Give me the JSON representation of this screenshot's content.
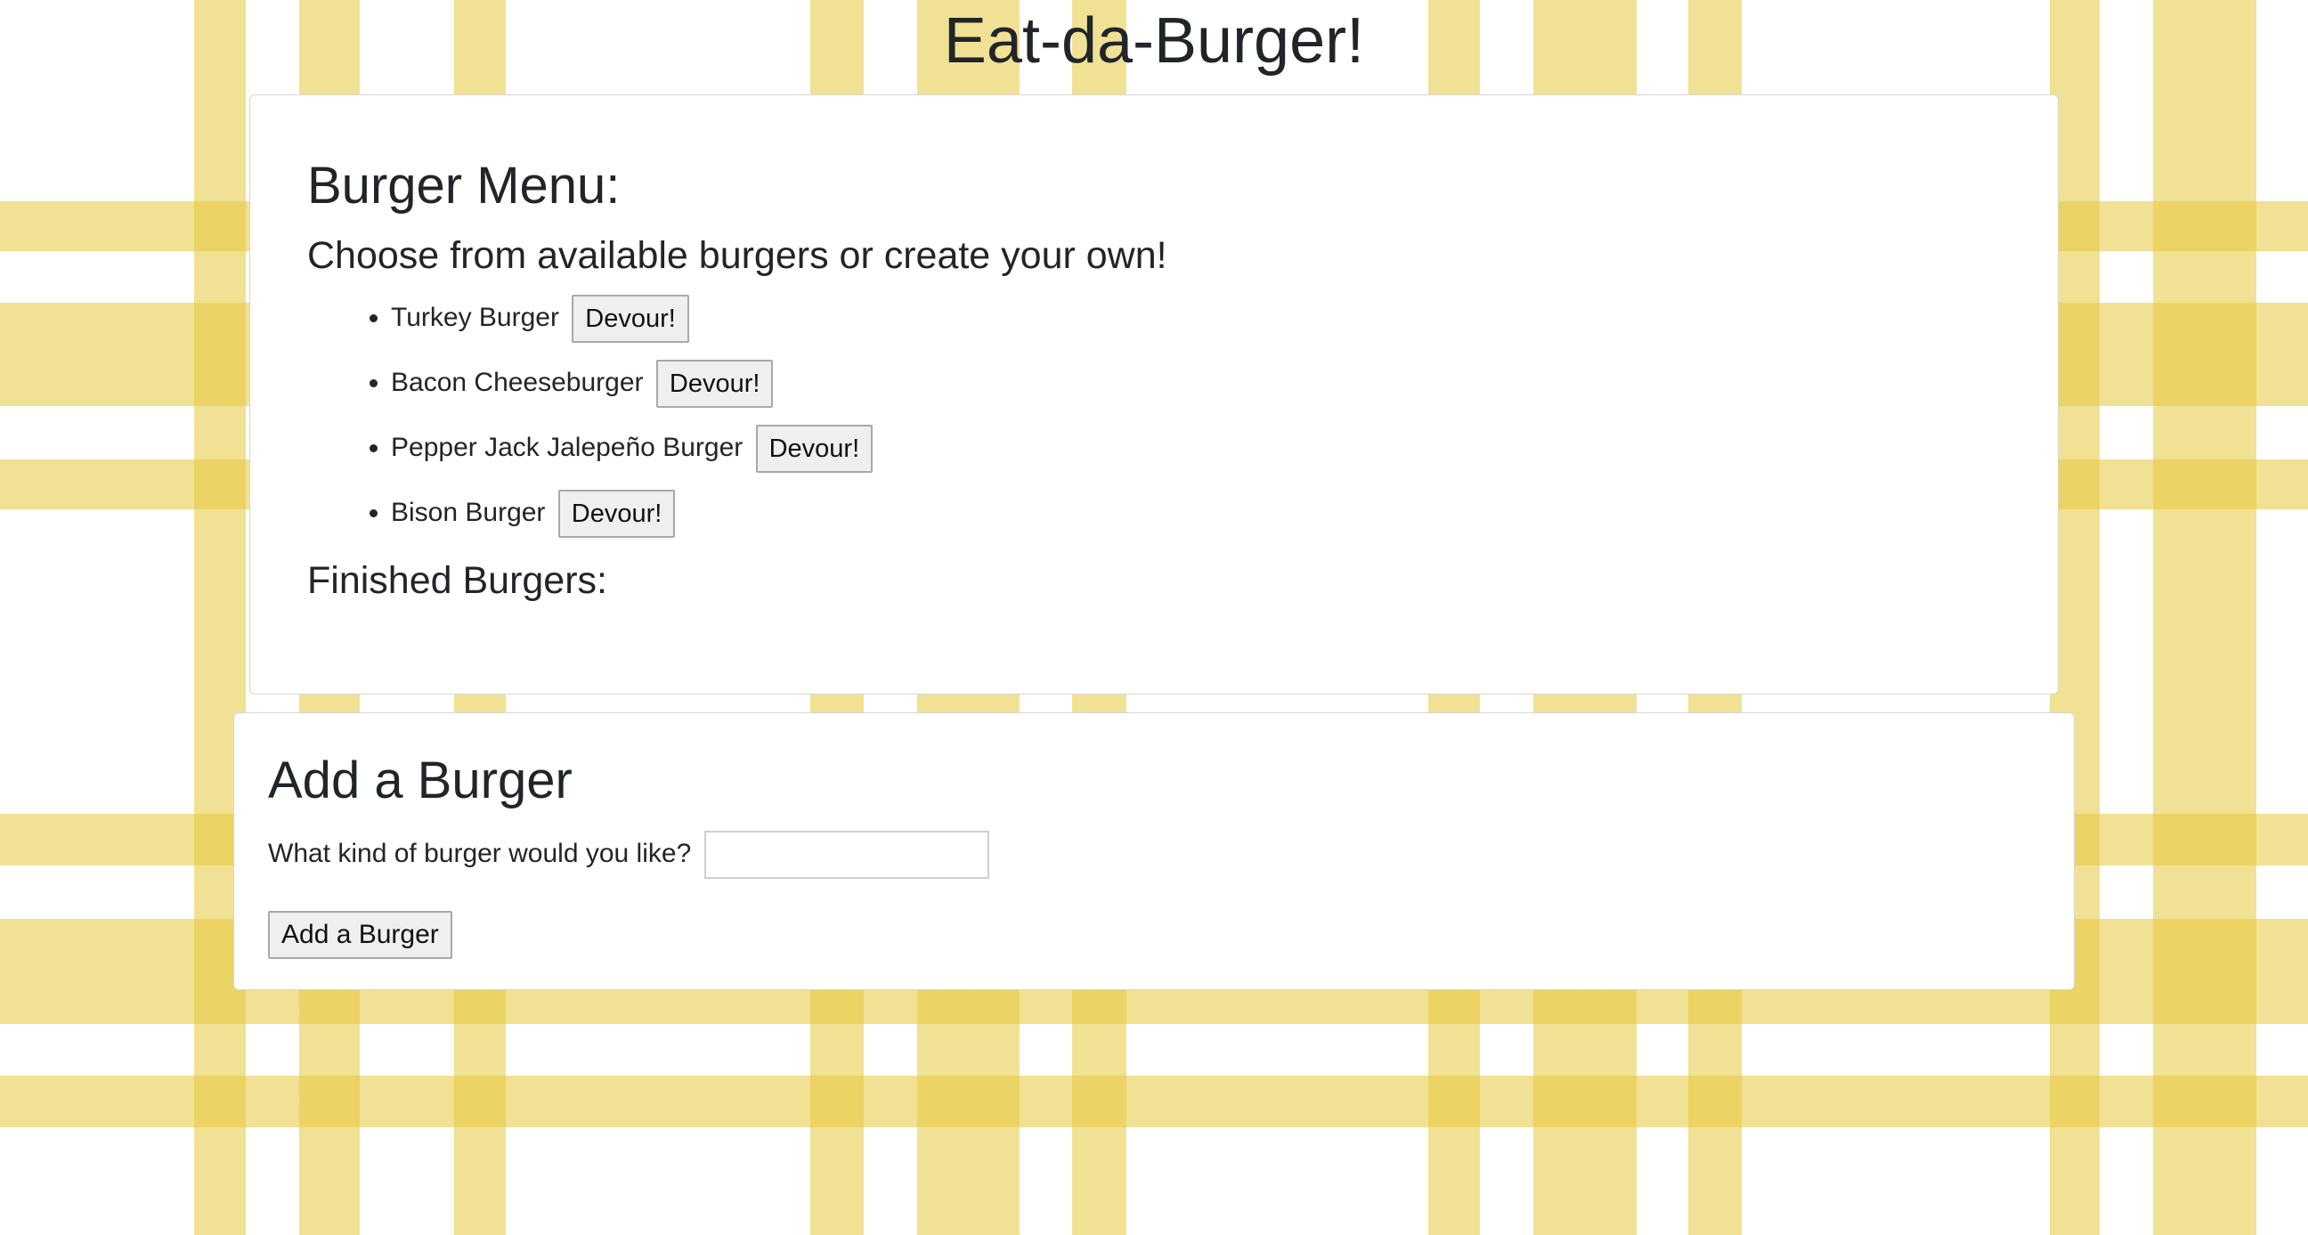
{
  "page": {
    "title": "Eat-da-Burger!"
  },
  "menu": {
    "heading": "Burger Menu:",
    "subtitle": "Choose from available burgers or create your own!",
    "burgers": [
      {
        "name": "Turkey Burger",
        "button": "Devour!"
      },
      {
        "name": "Bacon Cheeseburger",
        "button": "Devour!"
      },
      {
        "name": "Pepper Jack Jalepeño Burger",
        "button": "Devour!"
      },
      {
        "name": "Bison Burger",
        "button": "Devour!"
      }
    ],
    "finished_heading": "Finished Burgers:"
  },
  "add_form": {
    "heading": "Add a Burger",
    "prompt": "What kind of burger would you like?",
    "input_value": "",
    "submit_label": "Add a Burger"
  },
  "colors": {
    "tablecloth_stripe": "#e6c83c",
    "text": "#212529"
  }
}
